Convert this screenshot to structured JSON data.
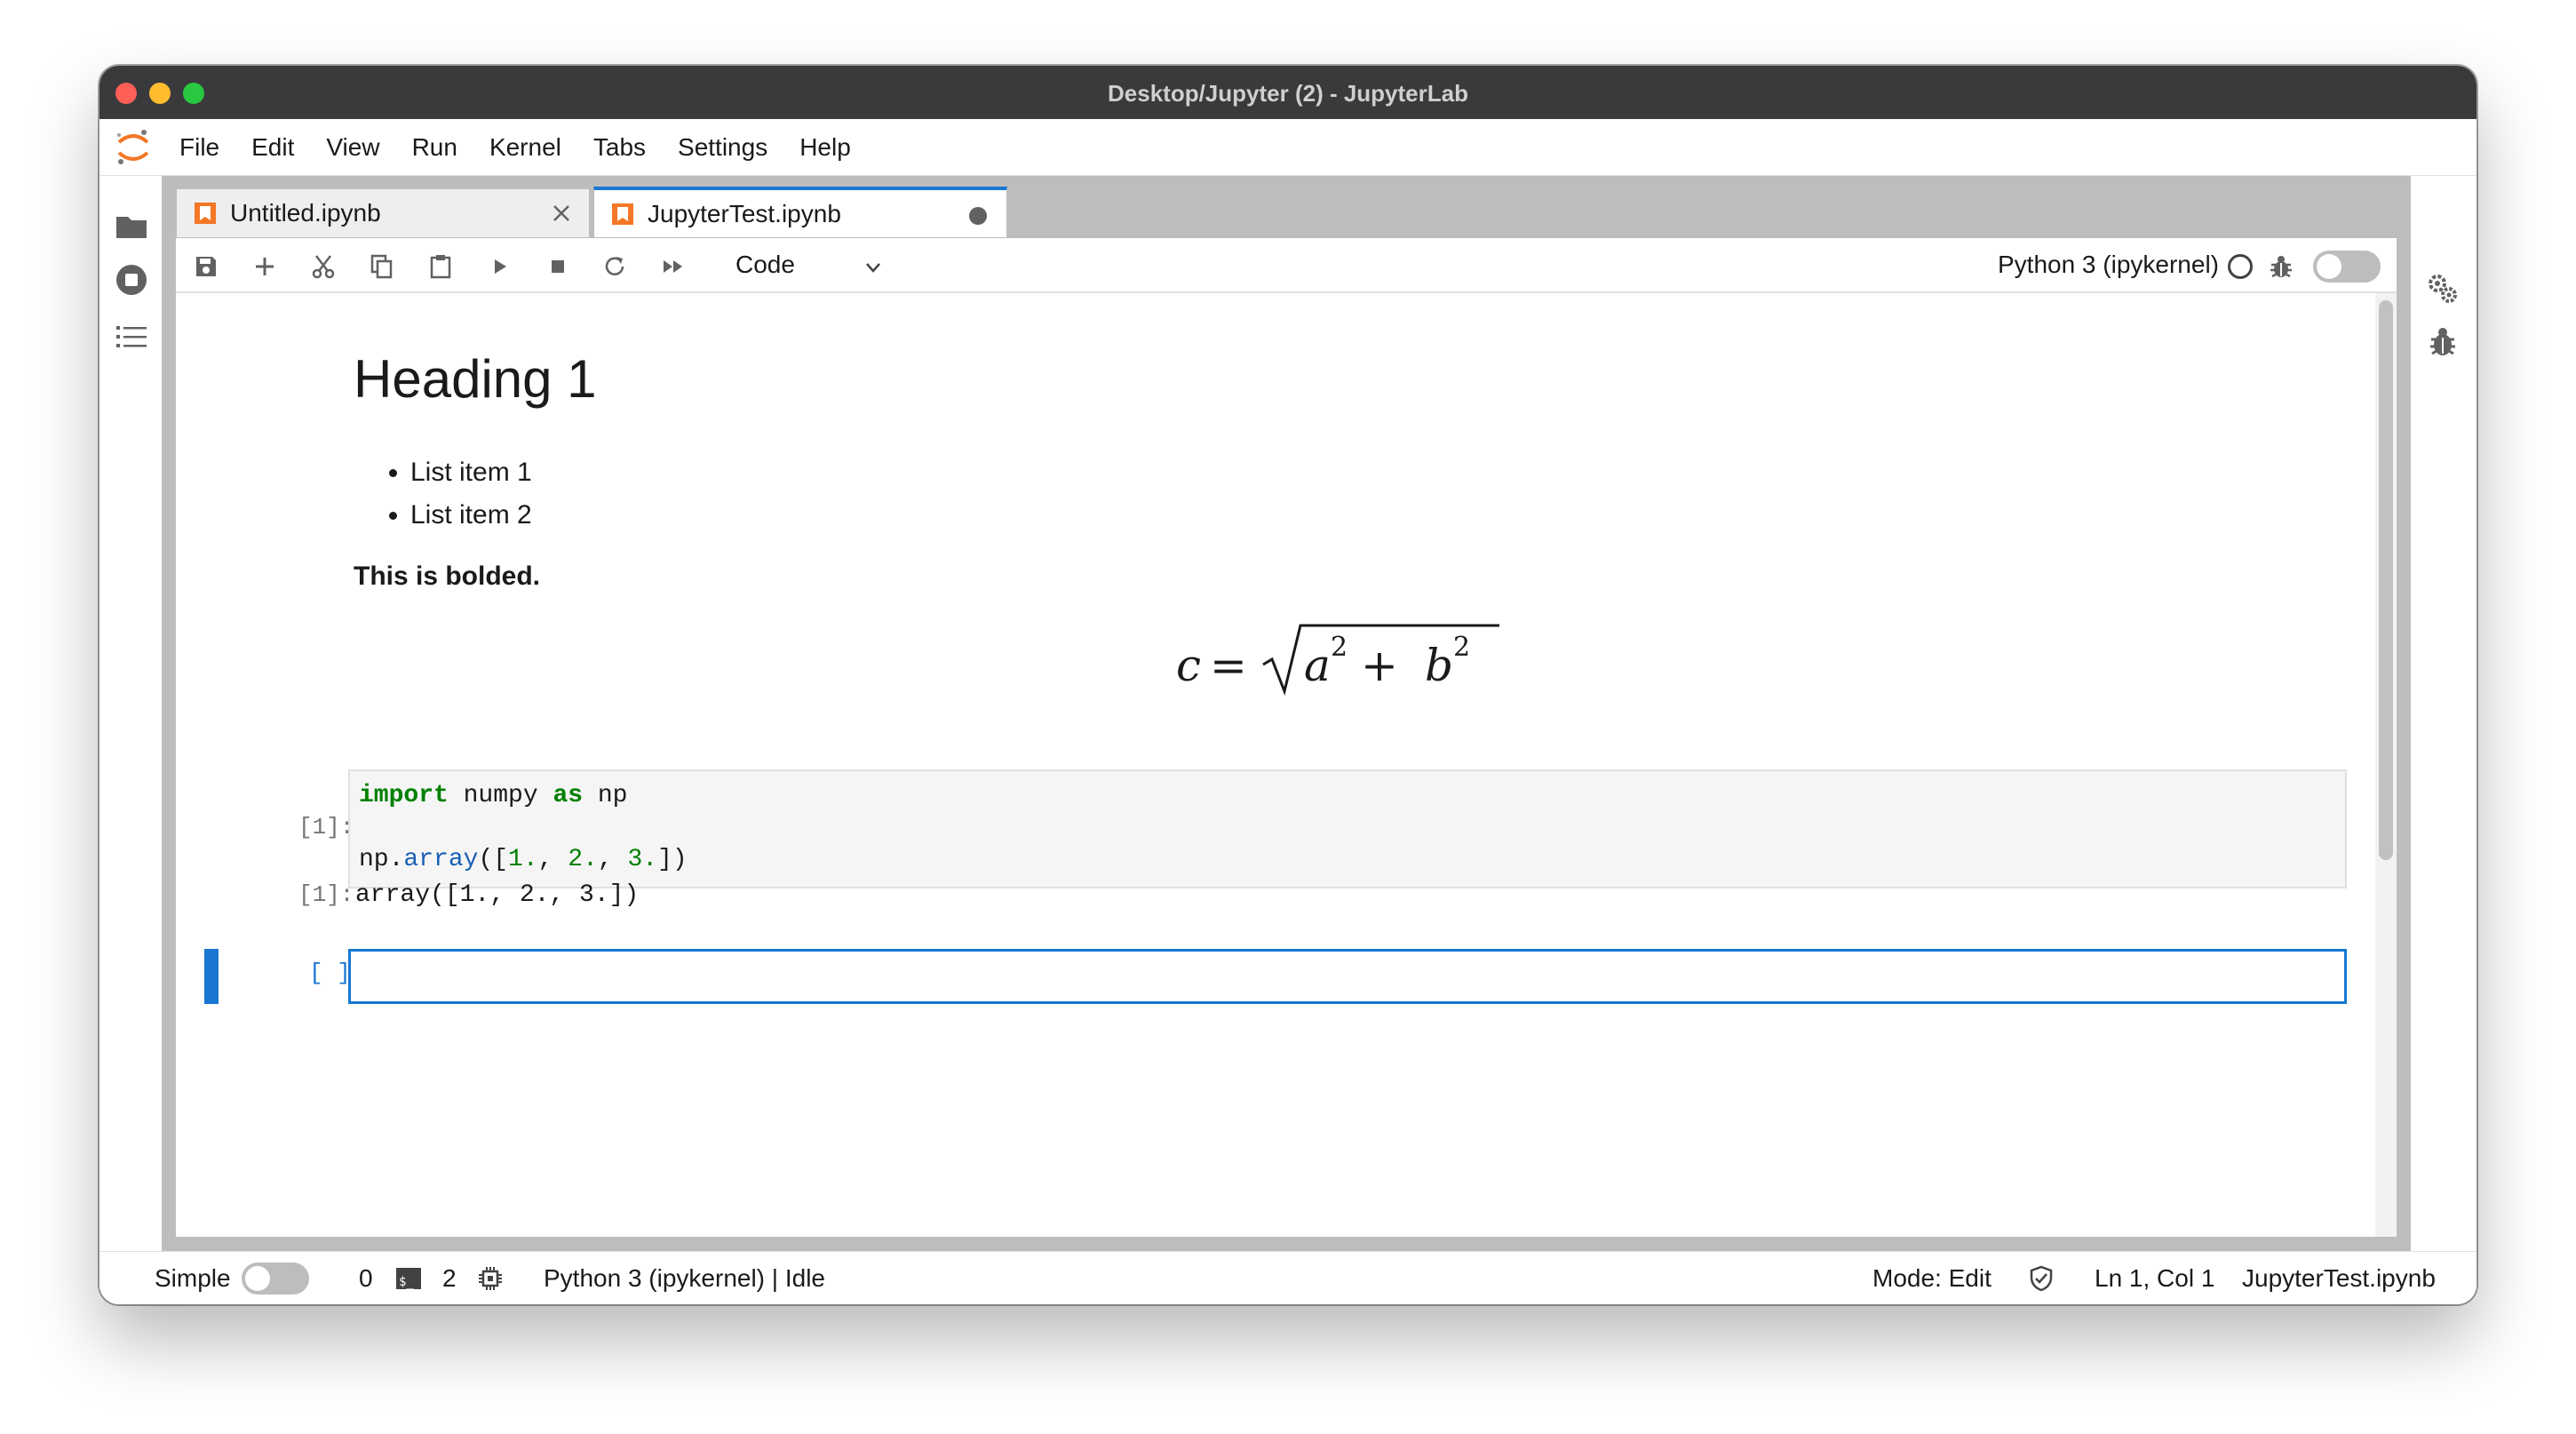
{
  "window": {
    "title": "Desktop/Jupyter (2) - JupyterLab"
  },
  "menu": {
    "items": [
      "File",
      "Edit",
      "View",
      "Run",
      "Kernel",
      "Tabs",
      "Settings",
      "Help"
    ]
  },
  "tabs": [
    {
      "label": "Untitled.ipynb",
      "active": false
    },
    {
      "label": "JupyterTest.ipynb",
      "active": true
    }
  ],
  "toolbar": {
    "cell_type": "Code",
    "kernel": "Python 3 (ipykernel)"
  },
  "notebook": {
    "markdown": {
      "heading": "Heading 1",
      "list_items": [
        "List item 1",
        "List item 2"
      ],
      "bold_text": "This is bolded.",
      "equation": "c = √(a² + b²)"
    },
    "code_cell": {
      "prompt": "[1]:",
      "line1": {
        "kw1": "import",
        "mid": " numpy ",
        "kw2": "as",
        "end": " np"
      },
      "line2": {
        "a": "np.",
        "fn": "array",
        "b": "([",
        "n1": "1.",
        "c": ", ",
        "n2": "2.",
        "d": ", ",
        "n3": "3.",
        "e": "])"
      }
    },
    "output": {
      "prompt": "[1]:",
      "text": "array([1., 2., 3.])"
    },
    "active_cell": {
      "prompt": "[ ]:"
    }
  },
  "statusbar": {
    "mode_label": "Simple",
    "terminals_count": "0",
    "kernels_count": "2",
    "kernel_status": "Python 3 (ipykernel) | Idle",
    "mode": "Mode: Edit",
    "position": "Ln 1, Col 1",
    "filename": "JupyterTest.ipynb"
  },
  "colors": {
    "accent": "#1976d2",
    "logo_orange": "#f37726",
    "keyword": "#008000",
    "function": "#1a5fb4"
  }
}
